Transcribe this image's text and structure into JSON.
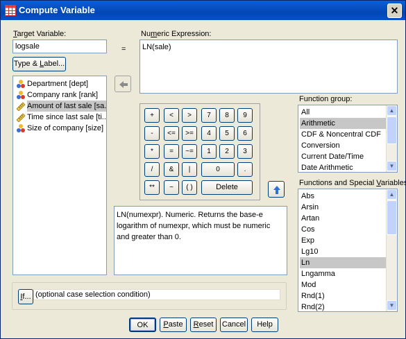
{
  "window": {
    "title": "Compute Variable",
    "close_glyph": "✕"
  },
  "target": {
    "label_u": "T",
    "label_rest": "arget Variable:",
    "value": "logsale",
    "equals": "="
  },
  "type_label_button": {
    "pre": "Type & ",
    "u": "L",
    "post": "abel..."
  },
  "variables": [
    {
      "label": "Department [dept]",
      "icon": "nominal-icon"
    },
    {
      "label": "Company rank [rank]",
      "icon": "nominal-icon"
    },
    {
      "label": "Amount of last sale [sa...",
      "icon": "scale-icon",
      "selected": true
    },
    {
      "label": "Time since last sale [ti...",
      "icon": "scale-icon"
    },
    {
      "label": "Size of company [size]",
      "icon": "nominal-icon"
    }
  ],
  "expression": {
    "label_pre": "Nu",
    "label_u": "m",
    "label_post": "eric Expression:",
    "value": "LN(sale)"
  },
  "keypad": {
    "keys": [
      "+",
      "<",
      ">",
      "7",
      "8",
      "9",
      "-",
      "<=",
      ">=",
      "4",
      "5",
      "6",
      "*",
      "=",
      "~=",
      "1",
      "2",
      "3",
      "/",
      "&",
      "|",
      "0",
      ".",
      "**",
      "~",
      "( )",
      "Delete"
    ]
  },
  "description": "LN(numexpr). Numeric. Returns the base-e logarithm of numexpr, which must be numeric and greater than 0.",
  "function_group": {
    "label_pre": "Function ",
    "label_u": "g",
    "label_post": "roup:",
    "items": [
      "All",
      "Arithmetic",
      "CDF & Noncentral CDF",
      "Conversion",
      "Current Date/Time",
      "Date Arithmetic"
    ],
    "selected": "Arithmetic"
  },
  "functions": {
    "label_pre": "Functions and Special ",
    "label_u": "V",
    "label_post": "ariables:",
    "items": [
      "Abs",
      "Arsin",
      "Artan",
      "Cos",
      "Exp",
      "Lg10",
      "Ln",
      "Lngamma",
      "Mod",
      "Rnd(1)",
      "Rnd(2)"
    ],
    "selected": "Ln"
  },
  "if_section": {
    "button_u": "I",
    "button_post": "f...",
    "text": "(optional case selection condition)"
  },
  "buttons": {
    "ok": "OK",
    "paste_u": "P",
    "paste_post": "aste",
    "reset_u": "R",
    "reset_post": "eset",
    "cancel": "Cancel",
    "help": "Help"
  },
  "colors": {
    "title_bar": "#0550cc",
    "dialog_bg": "#ece9d8",
    "selection": "#c7c7c7",
    "accent_arrow": "#2e6fd8"
  }
}
